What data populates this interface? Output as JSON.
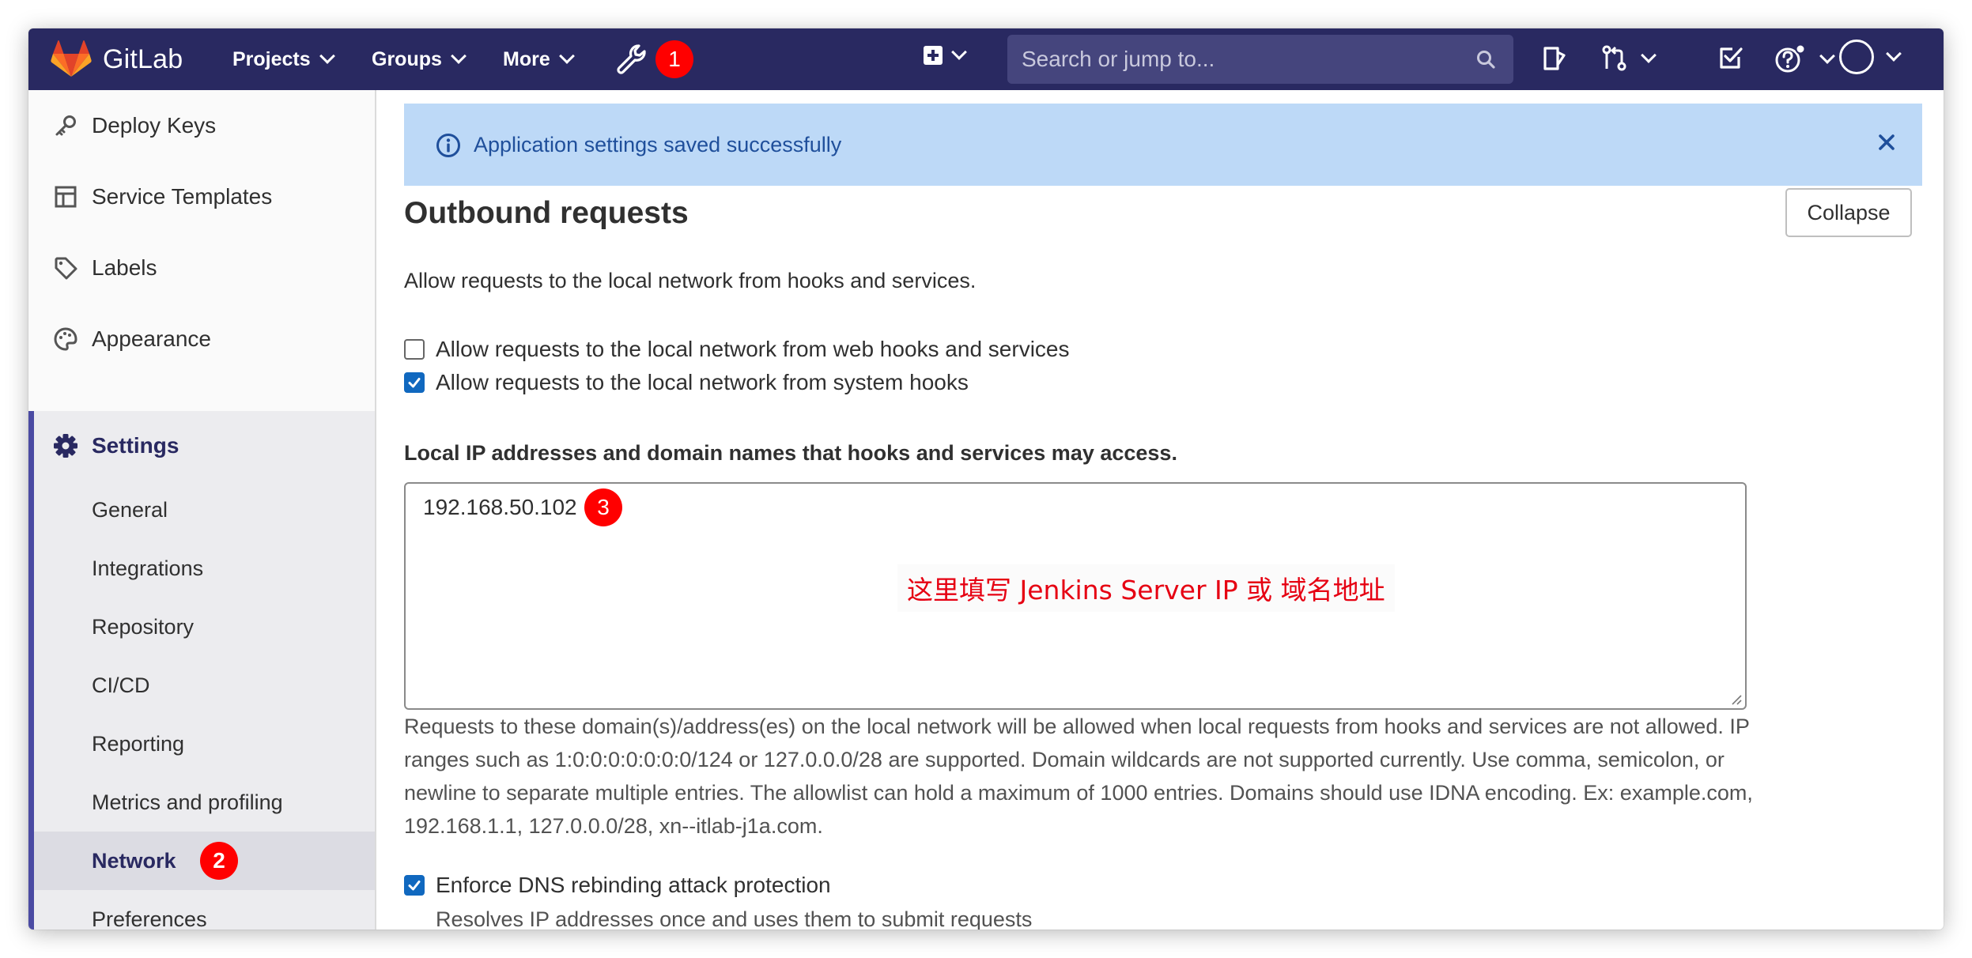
{
  "navbar": {
    "logo_text": "GitLab",
    "menus": [
      {
        "label": "Projects"
      },
      {
        "label": "Groups"
      },
      {
        "label": "More"
      }
    ],
    "admin_badge": "1",
    "search_placeholder": "Search or jump to...",
    "icons": [
      "wrench-icon",
      "plus-square-icon",
      "search-icon",
      "issues-icon",
      "merge-request-icon",
      "todo-icon",
      "help-icon",
      "avatar"
    ]
  },
  "sidebar": {
    "items": [
      {
        "label": "Deploy Keys",
        "icon": "key-icon"
      },
      {
        "label": "Service Templates",
        "icon": "template-icon"
      },
      {
        "label": "Labels",
        "icon": "label-icon"
      },
      {
        "label": "Appearance",
        "icon": "palette-icon"
      }
    ],
    "settings_label": "Settings",
    "sub_items": [
      {
        "label": "General"
      },
      {
        "label": "Integrations"
      },
      {
        "label": "Repository"
      },
      {
        "label": "CI/CD"
      },
      {
        "label": "Reporting"
      },
      {
        "label": "Metrics and profiling"
      },
      {
        "label": "Network"
      },
      {
        "label": "Preferences"
      }
    ],
    "network_badge": "2"
  },
  "flash": {
    "message": "Application settings saved successfully"
  },
  "section": {
    "title": "Outbound requests",
    "collapse_label": "Collapse",
    "description": "Allow requests to the local network from hooks and services.",
    "checkboxes": [
      {
        "label": "Allow requests to the local network from web hooks and services",
        "checked": false
      },
      {
        "label": "Allow requests to the local network from system hooks",
        "checked": true
      }
    ],
    "allowlist_label": "Local IP addresses and domain names that hooks and services may access.",
    "allowlist_value": "192.168.50.102",
    "allowlist_badge": "3",
    "annotation": "这里填写 Jenkins Server IP 或 域名地址",
    "help_text": "Requests to these domain(s)/address(es) on the local network will be allowed when local requests from hooks and services are not allowed. IP ranges such as 1:0:0:0:0:0:0:0/124 or 127.0.0.0/28 are supported. Domain wildcards are not supported currently. Use comma, semicolon, or newline to separate multiple entries. The allowlist can hold a maximum of 1000 entries. Domains should use IDNA encoding. Ex: example.com, 192.168.1.1, 127.0.0.0/28, xn--itlab-j1a.com.",
    "dns_label": "Enforce DNS rebinding attack protection",
    "dns_checked": true,
    "dns_help": "Resolves IP addresses once and uses them to submit requests"
  },
  "colors": {
    "navbar": "#292961",
    "flash_bg": "#bdd9f7",
    "flash_text": "#1f4f9b",
    "badge": "#ff0000",
    "annotation": "#e60012",
    "checkbox": "#1068bf"
  }
}
